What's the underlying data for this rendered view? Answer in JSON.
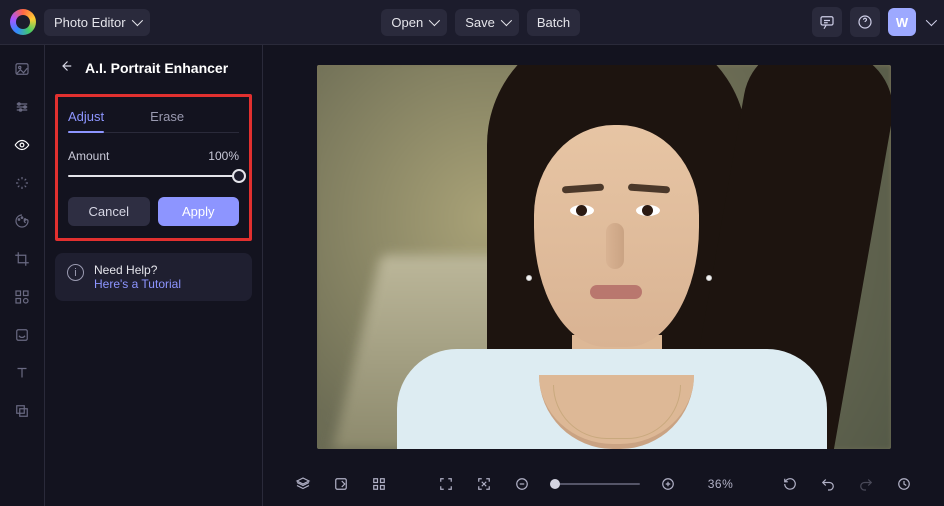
{
  "topbar": {
    "app_menu": "Photo Editor",
    "open": "Open",
    "save": "Save",
    "batch": "Batch",
    "avatar_initial": "W"
  },
  "panel": {
    "title": "A.I. Portrait Enhancer",
    "tab_adjust": "Adjust",
    "tab_erase": "Erase",
    "amount_label": "Amount",
    "amount_value": "100%",
    "cancel": "Cancel",
    "apply": "Apply"
  },
  "help": {
    "line1": "Need Help?",
    "line2": "Here's a Tutorial"
  },
  "bottom": {
    "zoom_pct": "36%"
  }
}
